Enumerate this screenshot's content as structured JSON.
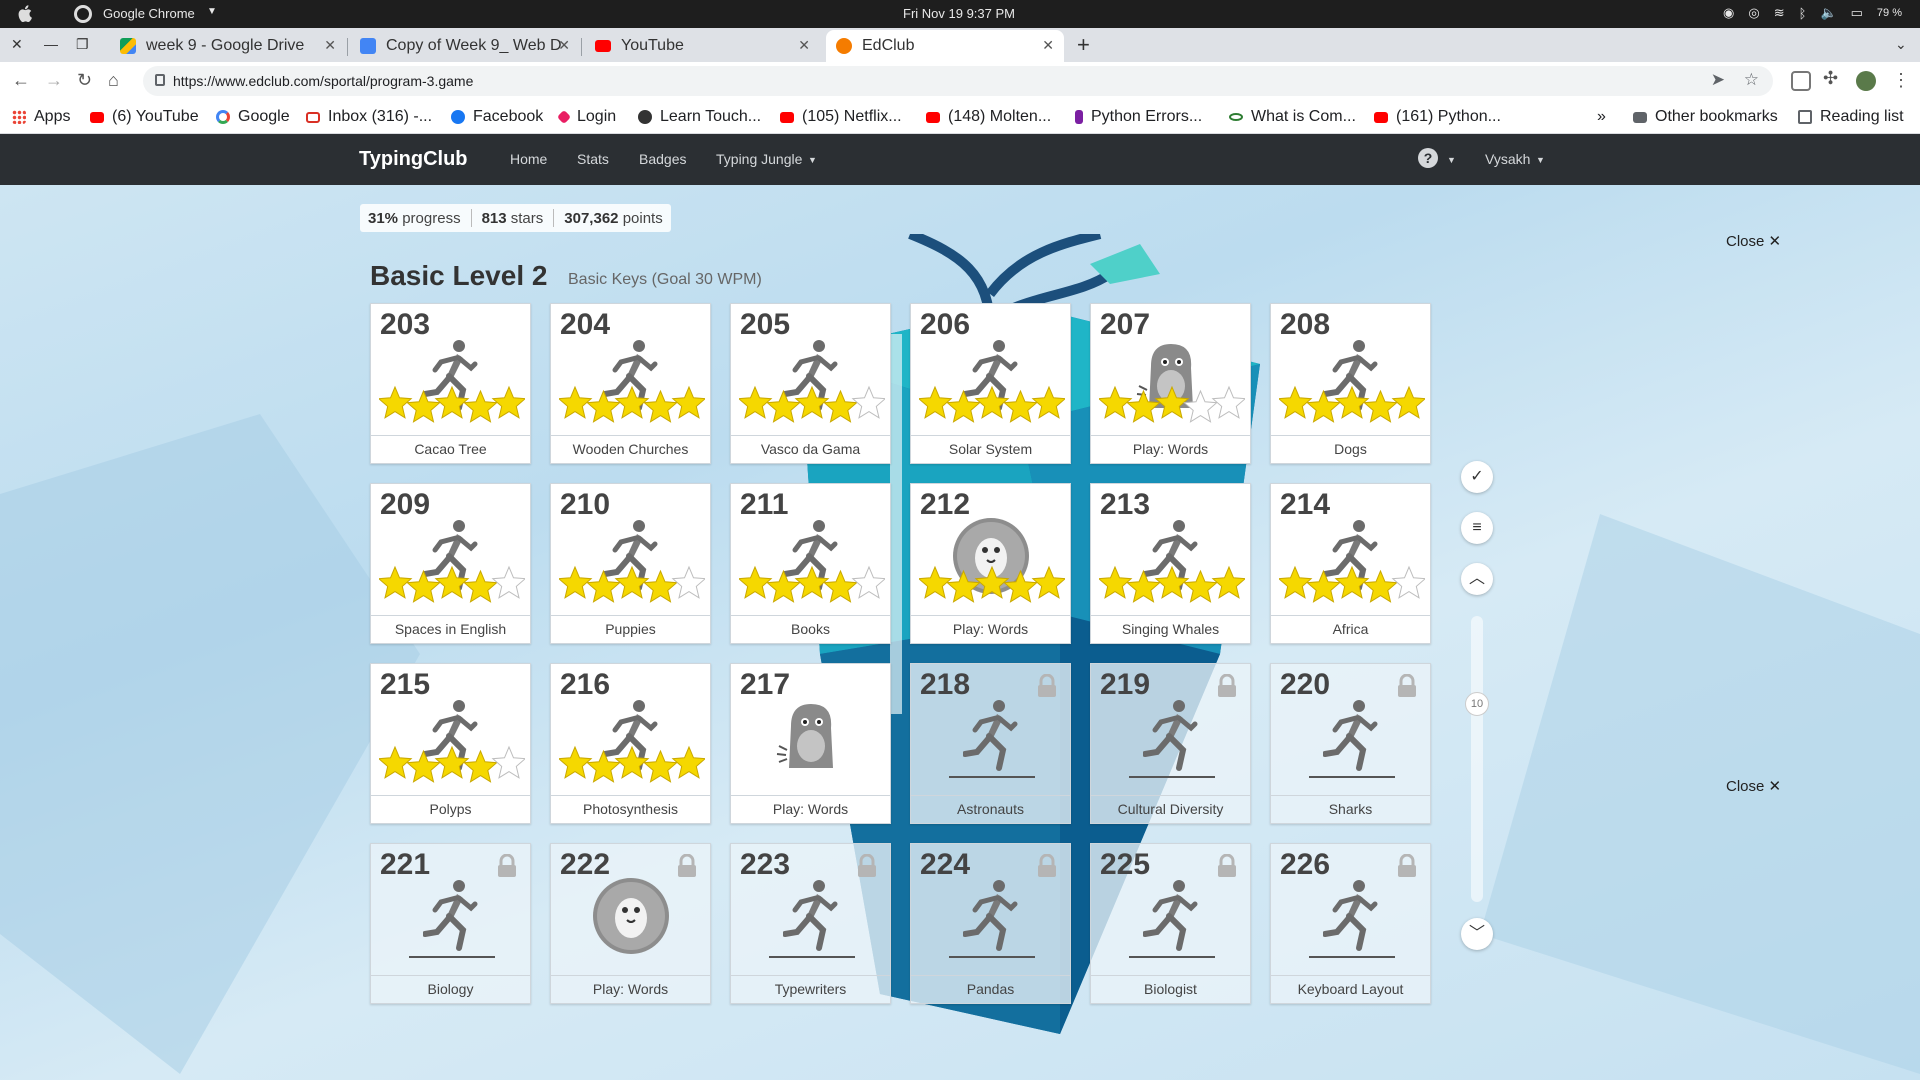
{
  "os_bar": {
    "app_name": "Google Chrome",
    "clock": "Fri Nov 19  9:37 PM",
    "battery": "79 %"
  },
  "tabs": [
    {
      "title": "week 9 - Google Drive",
      "favicon": "google-drive-icon",
      "color": "#1ea362"
    },
    {
      "title": "Copy of Week 9_ Web D",
      "favicon": "google-docs-icon",
      "color": "#4285f4"
    },
    {
      "title": "YouTube",
      "favicon": "youtube-icon",
      "color": "#ff0000"
    },
    {
      "title": "EdClub",
      "favicon": "edclub-icon",
      "color": "#f57c00",
      "active": true
    }
  ],
  "address_bar": {
    "url": "https://www.edclub.com/sportal/program-3.game"
  },
  "bookmarks": [
    {
      "label": "Apps",
      "icon": "apps-grid-icon",
      "color": "#4285f4"
    },
    {
      "label": "(6) YouTube",
      "icon": "youtube-icon",
      "color": "#ff0000"
    },
    {
      "label": "Google",
      "icon": "google-icon",
      "color": "#4285f4"
    },
    {
      "label": "Inbox (316) -...",
      "icon": "gmail-icon",
      "color": "#d93025"
    },
    {
      "label": "Facebook",
      "icon": "facebook-icon",
      "color": "#1877f2"
    },
    {
      "label": "Login",
      "icon": "login-icon",
      "color": "#e91e63"
    },
    {
      "label": "Learn Touch...",
      "icon": "typing-icon",
      "color": "#333333"
    },
    {
      "label": "(105) Netflix...",
      "icon": "youtube-icon",
      "color": "#ff0000"
    },
    {
      "label": "(148) Molten...",
      "icon": "youtube-icon",
      "color": "#ff0000"
    },
    {
      "label": "Python Errors...",
      "icon": "python-icon",
      "color": "#7b1fa2"
    },
    {
      "label": "What is Com...",
      "icon": "link-icon",
      "color": "#2e7d32"
    },
    {
      "label": "(161) Python...",
      "icon": "youtube-icon",
      "color": "#ff0000"
    }
  ],
  "bookmarks_right": {
    "more": "»",
    "other": "Other bookmarks",
    "reading": "Reading list"
  },
  "navbar": {
    "brand": "TypingClub",
    "links": [
      "Home",
      "Stats",
      "Badges",
      "Typing Jungle"
    ],
    "help": "?",
    "user": "Vysakh"
  },
  "stats": {
    "progress": "31%",
    "progress_label": "progress",
    "stars": "813",
    "stars_label": "stars",
    "points": "307,362",
    "points_label": "points"
  },
  "level": {
    "title": "Basic Level 2",
    "subtitle": "Basic Keys (Goal 30 WPM)"
  },
  "close_label": "Close",
  "lessons": [
    {
      "num": "203",
      "label": "Cacao Tree",
      "kind": "runner",
      "stars": 5
    },
    {
      "num": "204",
      "label": "Wooden Churches",
      "kind": "runner",
      "stars": 5
    },
    {
      "num": "205",
      "label": "Vasco da Gama",
      "kind": "runner",
      "stars": 4
    },
    {
      "num": "206",
      "label": "Solar System",
      "kind": "runner",
      "stars": 5
    },
    {
      "num": "207",
      "label": "Play: Words",
      "kind": "monster",
      "stars": 3
    },
    {
      "num": "208",
      "label": "Dogs",
      "kind": "runner",
      "stars": 5
    },
    {
      "num": "209",
      "label": "Spaces in English",
      "kind": "runner",
      "stars": 4
    },
    {
      "num": "210",
      "label": "Puppies",
      "kind": "runner",
      "stars": 4
    },
    {
      "num": "211",
      "label": "Books",
      "kind": "runner",
      "stars": 4
    },
    {
      "num": "212",
      "label": "Play: Words",
      "kind": "bird",
      "stars": 5
    },
    {
      "num": "213",
      "label": "Singing Whales",
      "kind": "runner",
      "stars": 5
    },
    {
      "num": "214",
      "label": "Africa",
      "kind": "runner",
      "stars": 4
    },
    {
      "num": "215",
      "label": "Polyps",
      "kind": "runner",
      "stars": 4
    },
    {
      "num": "216",
      "label": "Photosynthesis",
      "kind": "runner",
      "stars": 5
    },
    {
      "num": "217",
      "label": "Play: Words",
      "kind": "monster",
      "stars": 0
    },
    {
      "num": "218",
      "label": "Astronauts",
      "kind": "runner",
      "stars": 0,
      "locked": true
    },
    {
      "num": "219",
      "label": "Cultural Diversity",
      "kind": "runner",
      "stars": 0,
      "locked": true
    },
    {
      "num": "220",
      "label": "Sharks",
      "kind": "runner",
      "stars": 0,
      "locked": true
    },
    {
      "num": "221",
      "label": "Biology",
      "kind": "runner",
      "stars": 0,
      "locked": true
    },
    {
      "num": "222",
      "label": "Play: Words",
      "kind": "bird",
      "stars": 0,
      "locked": true
    },
    {
      "num": "223",
      "label": "Typewriters",
      "kind": "runner",
      "stars": 0,
      "locked": true
    },
    {
      "num": "224",
      "label": "Pandas",
      "kind": "runner",
      "stars": 0,
      "locked": true
    },
    {
      "num": "225",
      "label": "Biologist",
      "kind": "runner",
      "stars": 0,
      "locked": true
    },
    {
      "num": "226",
      "label": "Keyboard Layout",
      "kind": "runner",
      "stars": 0,
      "locked": true
    }
  ],
  "scroll_indicator": "10",
  "colors": {
    "star": "#f5d800",
    "navbar": "#2b2f33",
    "island": "#1aa0b8"
  }
}
